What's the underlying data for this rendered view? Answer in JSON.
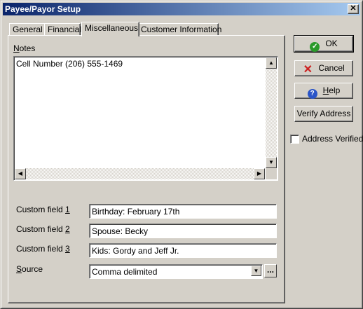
{
  "window": {
    "title": "Payee/Payor Setup",
    "close_glyph": "✕"
  },
  "tabs": [
    {
      "label": "General"
    },
    {
      "label": "Financial"
    },
    {
      "label": "Miscellaneous"
    },
    {
      "label": "Customer Information"
    }
  ],
  "notes": {
    "label_prefix": "",
    "label_mnemonic": "N",
    "label_rest": "otes",
    "text": "Cell Number (206) 555-1469"
  },
  "custom_fields": [
    {
      "label_text": "Custom field ",
      "mnemonic": "1",
      "value": "Birthday: February 17th"
    },
    {
      "label_text": "Custom field ",
      "mnemonic": "2",
      "value": "Spouse: Becky"
    },
    {
      "label_text": "Custom field ",
      "mnemonic": "3",
      "value": "Kids: Gordy and Jeff Jr."
    }
  ],
  "source": {
    "label_mnemonic": "S",
    "label_rest": "ource",
    "value": "Comma delimited",
    "ellipsis": "..."
  },
  "buttons": {
    "ok": {
      "label": "OK",
      "color": "#2a9a2a"
    },
    "cancel": {
      "label": "Cancel",
      "color": "#cc1f1f"
    },
    "help": {
      "mnemonic": "H",
      "rest": "elp",
      "color": "#2a55c8"
    },
    "verify": {
      "label": "Verify Address"
    }
  },
  "address_verified": {
    "label": "Address Verified",
    "checked": false
  }
}
